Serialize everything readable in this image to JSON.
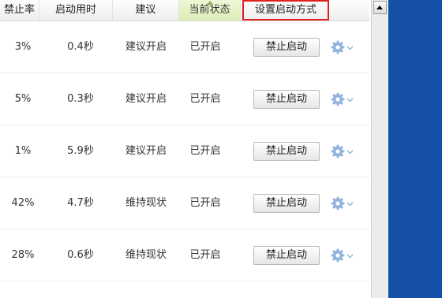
{
  "columns": {
    "ban_rate": "禁止率",
    "startup_time": "启动用时",
    "suggestion": "建议",
    "current_state": "当前状态",
    "set_startup_mode": "设置启动方式"
  },
  "rows": [
    {
      "ban_rate": "3%",
      "startup_time": "0.4秒",
      "suggestion": "建议开启",
      "state": "已开启",
      "action": "禁止启动"
    },
    {
      "ban_rate": "5%",
      "startup_time": "0.3秒",
      "suggestion": "建议开启",
      "state": "已开启",
      "action": "禁止启动"
    },
    {
      "ban_rate": "1%",
      "startup_time": "5.9秒",
      "suggestion": "建议开启",
      "state": "已开启",
      "action": "禁止启动"
    },
    {
      "ban_rate": "42%",
      "startup_time": "4.7秒",
      "suggestion": "维持现状",
      "state": "已开启",
      "action": "禁止启动"
    },
    {
      "ban_rate": "28%",
      "startup_time": "0.6秒",
      "suggestion": "维持现状",
      "state": "已开启",
      "action": "禁止启动"
    }
  ],
  "colors": {
    "highlight_border": "#e0201a",
    "current_column_header": "#dcecb6",
    "gear_icon": "#8fb3dc",
    "side_panel": "#1450a6"
  },
  "icons": {
    "row_menu": "gear-icon",
    "row_menu_dropdown": "chevron-down-icon",
    "scroll_up": "arrow-up-icon"
  }
}
